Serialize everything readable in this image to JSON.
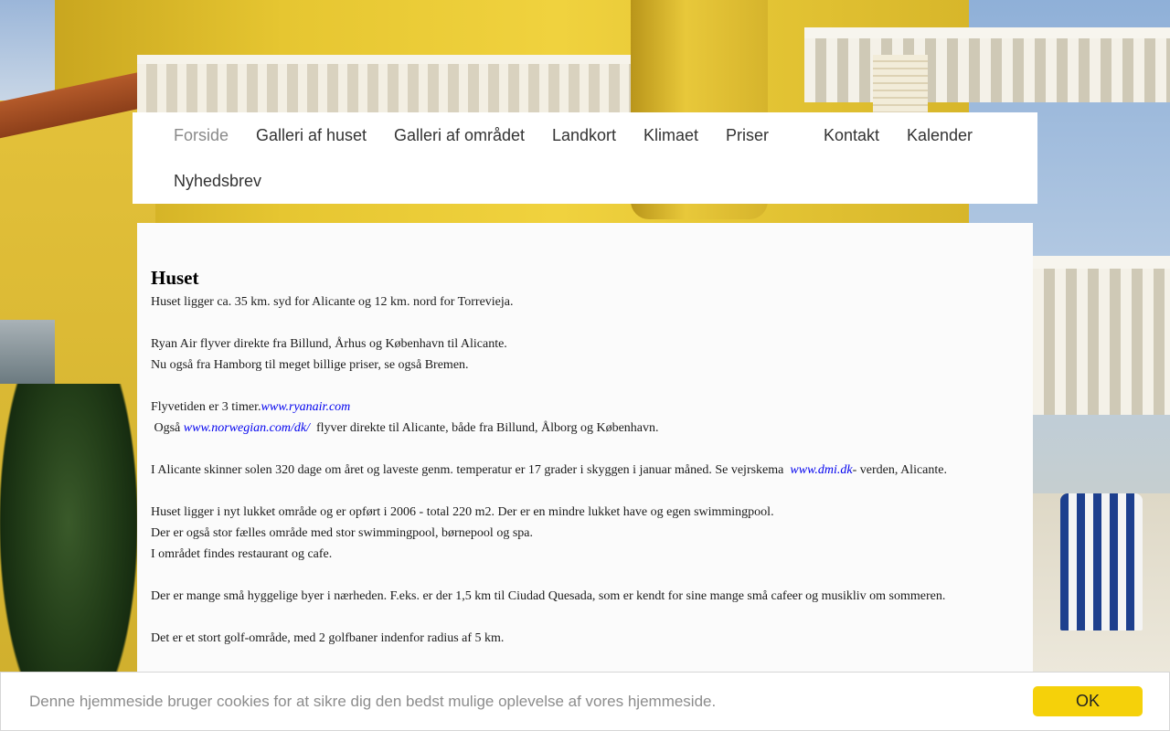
{
  "nav": {
    "items": [
      {
        "label": "Forside"
      },
      {
        "label": "Galleri af huset"
      },
      {
        "label": "Galleri af området"
      },
      {
        "label": "Landkort"
      },
      {
        "label": "Klimaet"
      },
      {
        "label": "Priser"
      },
      {
        "label": "Kontakt"
      },
      {
        "label": "Kalender"
      },
      {
        "label": "Nyhedsbrev"
      }
    ],
    "active_index": 0
  },
  "content": {
    "heading": "Huset",
    "p1": "Huset ligger ca. 35 km. syd for Alicante og 12 km. nord for Torrevieja.",
    "p2": "Ryan Air flyver direkte fra Billund, Århus og København  til Alicante.",
    "p3": "Nu også fra Hamborg til meget billige priser, se også Bremen.",
    "p4_text": "Flyvetiden er 3 timer.",
    "p4_link": "www.ryanair.com",
    "p5_pre": " Også ",
    "p5_link": "www.norwegian.com/dk/",
    "p5_post": "  flyver direkte til Alicante, både fra Billund, Ålborg og København.",
    "p6_pre": "I Alicante skinner solen 320 dage om året og laveste genm. temperatur er 17 grader i skyggen i januar måned. Se vejrskema  ",
    "p6_link": "www.dmi.dk",
    "p6_post": "- verden, Alicante.",
    "p7": "Huset ligger i nyt lukket område og er opført i 2006 - total 220 m2. Der er en mindre lukket have og egen swimmingpool.",
    "p8": "Der er også stor fælles område med stor swimmingpool, børnepool og spa.",
    "p9": "I området findes restaurant og cafe.",
    "p10": "Der er mange små hyggelige byer i nærheden. F.eks. er der 1,5 km til Ciudad Quesada, som er kendt for sine mange små cafeer og musikliv om sommeren.",
    "p11": "Det er et stort golf-område, med 2 golfbaner indenfor radius af 5 km."
  },
  "cookie": {
    "text": "Denne hjemmeside bruger cookies for at sikre dig den bedst mulige oplevelse af vores hjemmeside.",
    "button": "OK",
    "button_color": "#f5d10a"
  }
}
